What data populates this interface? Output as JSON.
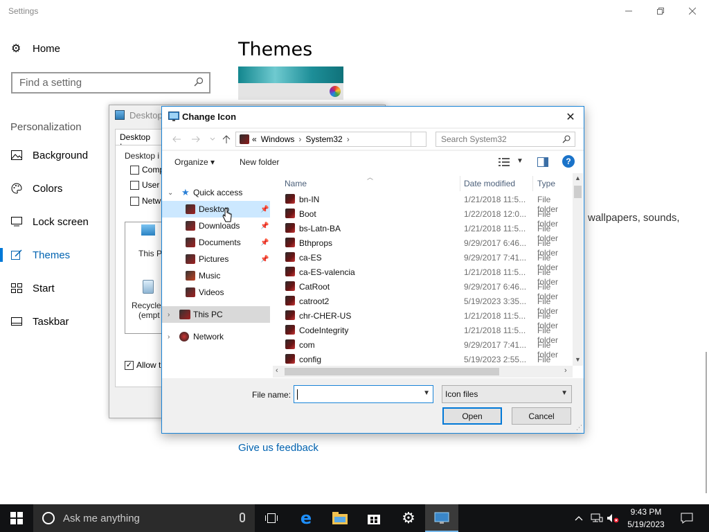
{
  "settings": {
    "app_title": "Settings",
    "home_label": "Home",
    "search_placeholder": "Find a setting",
    "section_label": "Personalization",
    "nav_items": [
      {
        "label": "Background"
      },
      {
        "label": "Colors"
      },
      {
        "label": "Lock screen"
      },
      {
        "label": "Themes",
        "selected": true
      },
      {
        "label": "Start"
      },
      {
        "label": "Taskbar"
      }
    ],
    "page_title": "Themes",
    "theme_desc_fragment": "wallpapers, sounds,",
    "feedback_link": "Give us feedback",
    "accent_color": "#0078d7"
  },
  "desktop_icon_settings": {
    "title": "Desktop",
    "tab_label": "Desktop Icon",
    "group_label": "Desktop i",
    "checks": [
      {
        "label": "Comp"
      },
      {
        "label": "User"
      },
      {
        "label": "Netw"
      }
    ],
    "icon_this_pc": "This P",
    "icon_recycle_1": "Recycle",
    "icon_recycle_2": "(empt",
    "allow_label": "Allow t",
    "allow_checked": "✓"
  },
  "change_icon": {
    "title": "Change Icon",
    "close_icon": "✕",
    "address": {
      "prefix": "«",
      "parts": [
        "Windows",
        "System32"
      ],
      "separator": "›"
    },
    "search_placeholder": "Search System32",
    "commands": {
      "organize": "Organize ▾",
      "new_folder": "New folder",
      "help": "?"
    },
    "tree": [
      {
        "label": "Quick access",
        "icon": "star-icon"
      },
      {
        "label": "Desktop",
        "icon": "desktop-icon",
        "pinned": true,
        "selected": true
      },
      {
        "label": "Downloads",
        "icon": "downloads-icon",
        "pinned": true
      },
      {
        "label": "Documents",
        "icon": "documents-icon",
        "pinned": true
      },
      {
        "label": "Pictures",
        "icon": "pictures-icon",
        "pinned": true
      },
      {
        "label": "Music",
        "icon": "music-icon"
      },
      {
        "label": "Videos",
        "icon": "videos-icon"
      },
      {
        "label": "This PC",
        "icon": "pc-icon"
      },
      {
        "label": "Network",
        "icon": "network-icon"
      }
    ],
    "columns": {
      "name": "Name",
      "date": "Date modified",
      "type": "Type"
    },
    "files": [
      {
        "name": "bn-IN",
        "date": "1/21/2018 11:5...",
        "type": "File folder"
      },
      {
        "name": "Boot",
        "date": "1/22/2018 12:0...",
        "type": "File folder"
      },
      {
        "name": "bs-Latn-BA",
        "date": "1/21/2018 11:5...",
        "type": "File folder"
      },
      {
        "name": "Bthprops",
        "date": "9/29/2017 6:46...",
        "type": "File folder"
      },
      {
        "name": "ca-ES",
        "date": "9/29/2017 7:41...",
        "type": "File folder"
      },
      {
        "name": "ca-ES-valencia",
        "date": "1/21/2018 11:5...",
        "type": "File folder"
      },
      {
        "name": "CatRoot",
        "date": "9/29/2017 6:46...",
        "type": "File folder"
      },
      {
        "name": "catroot2",
        "date": "5/19/2023 3:35...",
        "type": "File folder"
      },
      {
        "name": "chr-CHER-US",
        "date": "1/21/2018 11:5...",
        "type": "File folder"
      },
      {
        "name": "CodeIntegrity",
        "date": "1/21/2018 11:5...",
        "type": "File folder"
      },
      {
        "name": "com",
        "date": "9/29/2017 7:41...",
        "type": "File folder"
      },
      {
        "name": "config",
        "date": "5/19/2023 2:55...",
        "type": "File folder"
      }
    ],
    "file_name_label": "File name:",
    "file_name_value": "",
    "file_type_value": "Icon files",
    "open_button": "Open",
    "cancel_button": "Cancel"
  },
  "taskbar": {
    "search_text": "Ask me anything",
    "time": "9:43 PM",
    "date": "5/19/2023"
  }
}
